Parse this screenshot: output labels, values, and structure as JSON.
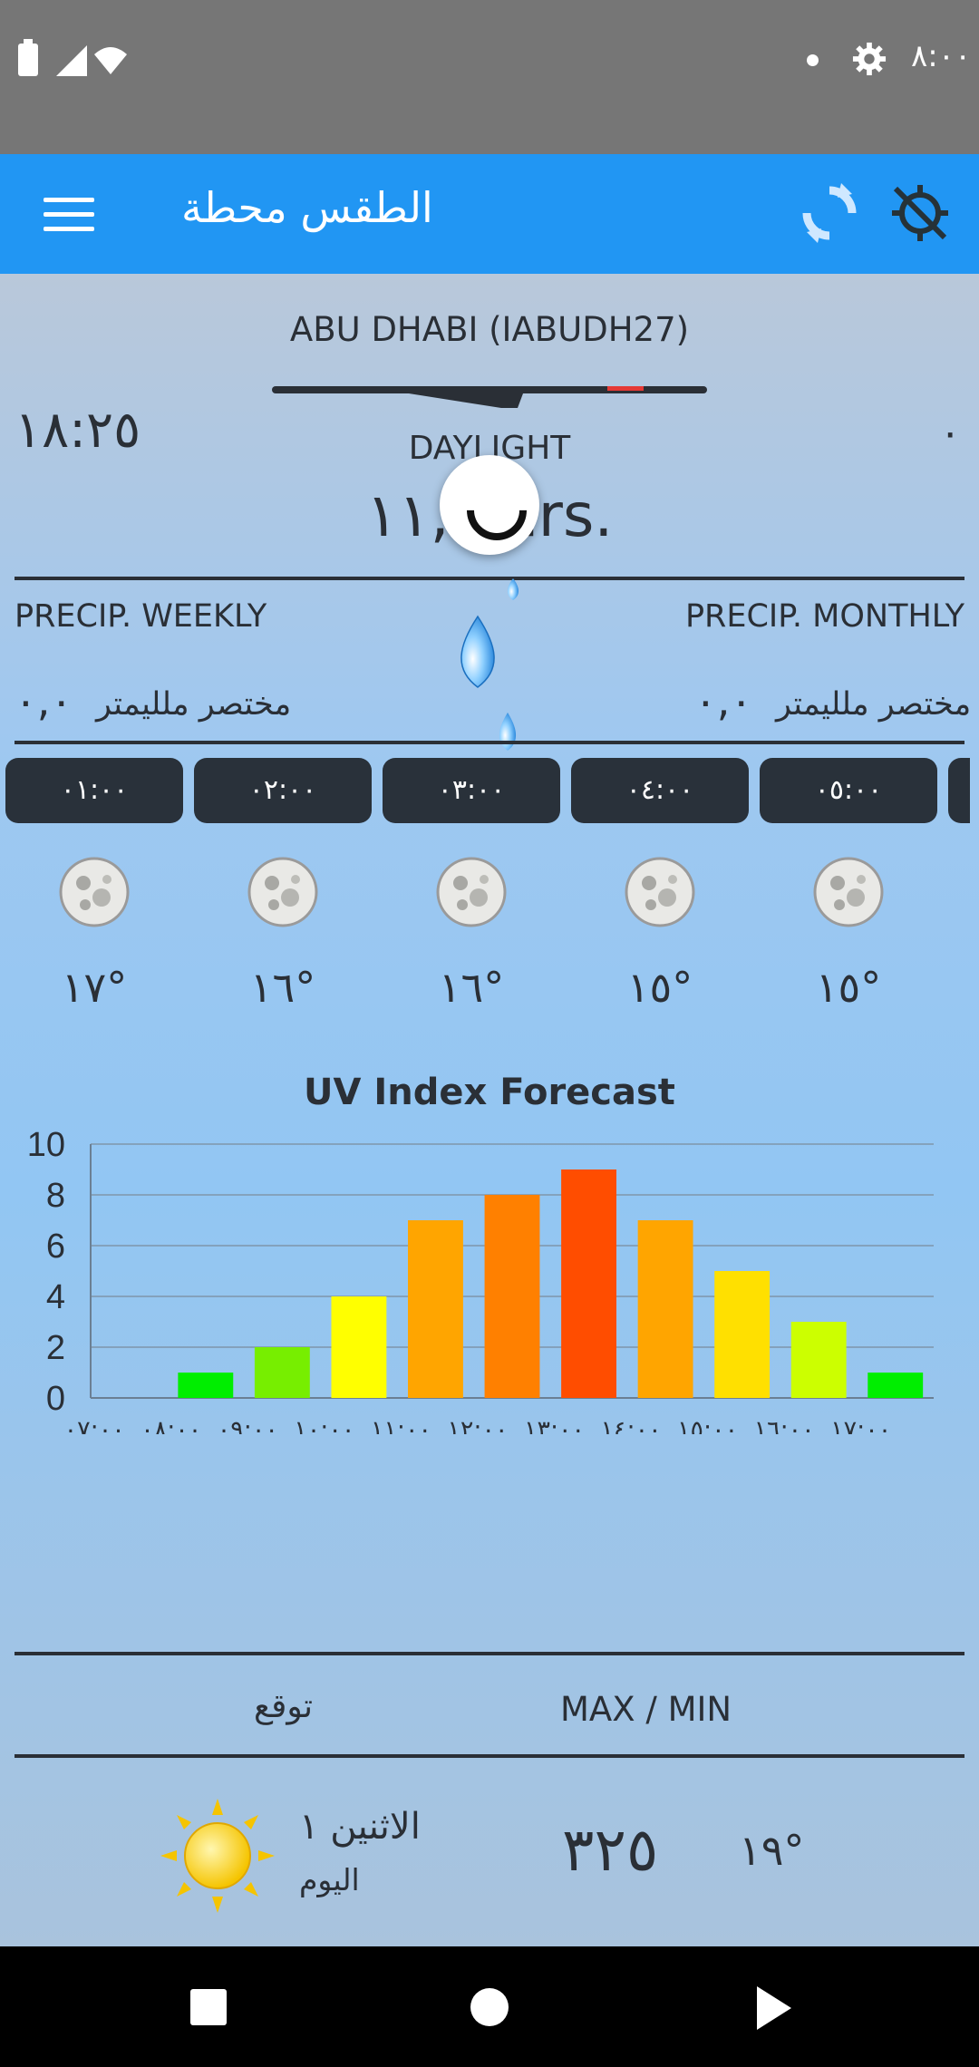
{
  "status_bar": {
    "time": "٨:٠٠"
  },
  "app_bar": {
    "title": "الطقس محطة"
  },
  "station": {
    "name": "ABU DHABI (IABUDH27)",
    "sunset_time": "١٨:٢٥",
    "right_value": "٠",
    "daylight_label": "DAYLIGHT",
    "daylight_value": "١١,٦ hrs."
  },
  "precip": {
    "weekly_label": "PRECIP. WEEKLY",
    "monthly_label": "PRECIP. MONTHLY",
    "weekly_value": "٠,٠",
    "monthly_value": "٠,٠",
    "unit": "مختصر ملليمتر"
  },
  "hourly": [
    {
      "time": "٠١:٠٠",
      "temp": "١٧°"
    },
    {
      "time": "٠٢:٠٠",
      "temp": "١٦°"
    },
    {
      "time": "٠٣:٠٠",
      "temp": "١٦°"
    },
    {
      "time": "٠٤:٠٠",
      "temp": "١٥°"
    },
    {
      "time": "٠٥:٠٠",
      "temp": "١٥°"
    }
  ],
  "chart_data": {
    "type": "bar",
    "title": "UV Index Forecast",
    "categories": [
      "٠٧:٠٠",
      "٠٨:٠٠",
      "٠٩:٠٠",
      "١٠:٠٠",
      "١١:٠٠",
      "١٢:٠٠",
      "١٣:٠٠",
      "١٤:٠٠",
      "١٥:٠٠",
      "١٦:٠٠",
      "١٧:٠٠"
    ],
    "values": [
      0,
      1,
      2,
      4,
      7,
      8,
      9,
      7,
      5,
      3,
      1
    ],
    "colors": [
      "#00ee00",
      "#00ee00",
      "#77ee00",
      "#ffff00",
      "#ffa500",
      "#ff8000",
      "#ff4d00",
      "#ffa500",
      "#ffe000",
      "#ccff00",
      "#00ee00"
    ],
    "ylim": [
      0,
      10
    ],
    "yticks": [
      0,
      2,
      4,
      6,
      8,
      10
    ],
    "grid": true
  },
  "forecast": {
    "label": "توقع",
    "maxmin_label": "MAX / MIN",
    "day_name": "الاثنين ١",
    "day_sub": "اليوم",
    "max": "٣٢٥",
    "min": "١٩°"
  },
  "icons": {
    "battery": "battery-icon",
    "signal": "signal-icon",
    "wifi": "wifi-icon",
    "settings": "gear-icon",
    "menu": "menu-icon",
    "refresh": "refresh-icon",
    "gps": "gps-off-icon",
    "moon": "moon-icon",
    "sun": "sun-icon",
    "drops": "water-drops-icon"
  },
  "colors": {
    "app_bar": "#2196f3",
    "chip": "#29313a",
    "text_dark": "#2a2f36"
  }
}
